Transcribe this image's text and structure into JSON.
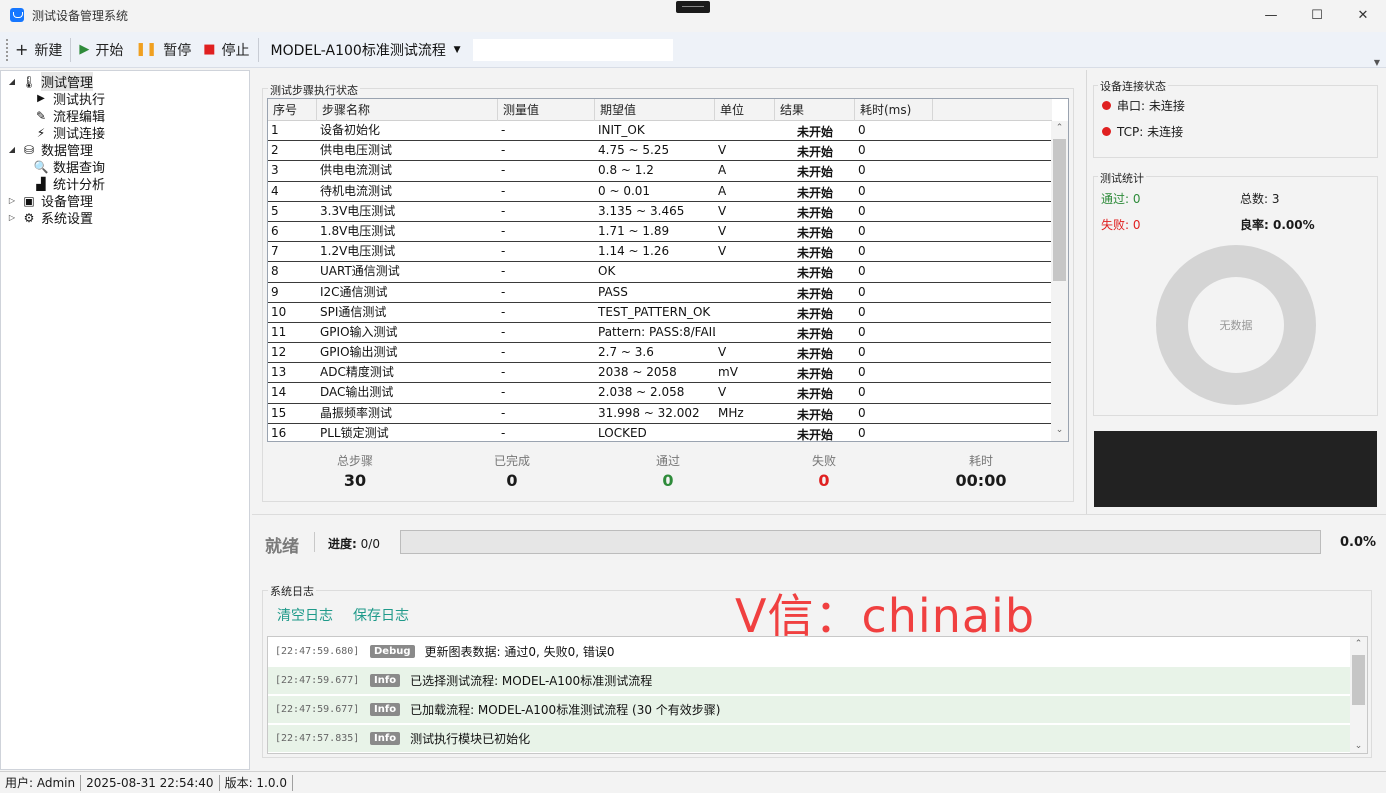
{
  "window": {
    "title": "测试设备管理系统",
    "minimize": "—",
    "maximize": "☐",
    "close": "✕"
  },
  "toolbar": {
    "new_label": "新建",
    "start_label": "开始",
    "pause_label": "暂停",
    "stop_label": "停止",
    "flow_selected": "MODEL-A100标准测试流程",
    "input_value": ""
  },
  "tree": [
    {
      "label": "测试管理",
      "level": 0,
      "expanded": true,
      "icon": "thermometer-icon"
    },
    {
      "label": "测试执行",
      "level": 1,
      "icon": "play-icon"
    },
    {
      "label": "流程编辑",
      "level": 1,
      "icon": "file-edit-icon"
    },
    {
      "label": "测试连接",
      "level": 1,
      "icon": "plug-icon"
    },
    {
      "label": "数据管理",
      "level": 0,
      "expanded": true,
      "icon": "database-icon"
    },
    {
      "label": "数据查询",
      "level": 1,
      "icon": "search-icon"
    },
    {
      "label": "统计分析",
      "level": 1,
      "icon": "bar-chart-icon"
    },
    {
      "label": "设备管理",
      "level": 0,
      "expanded": false,
      "icon": "device-icon"
    },
    {
      "label": "系统设置",
      "level": 0,
      "expanded": false,
      "icon": "gear-icon"
    }
  ],
  "steps": {
    "group_title": "测试步骤执行状态",
    "columns": [
      "序号",
      "步骤名称",
      "测量值",
      "期望值",
      "单位",
      "结果",
      "耗时(ms)"
    ],
    "rows": [
      [
        "1",
        "设备初始化",
        "-",
        "INIT_OK",
        "",
        "未开始",
        "0"
      ],
      [
        "2",
        "供电电压测试",
        "-",
        "4.75 ~ 5.25",
        "V",
        "未开始",
        "0"
      ],
      [
        "3",
        "供电电流测试",
        "-",
        "0.8 ~ 1.2",
        "A",
        "未开始",
        "0"
      ],
      [
        "4",
        "待机电流测试",
        "-",
        "0 ~ 0.01",
        "A",
        "未开始",
        "0"
      ],
      [
        "5",
        "3.3V电压测试",
        "-",
        "3.135 ~ 3.465",
        "V",
        "未开始",
        "0"
      ],
      [
        "6",
        "1.8V电压测试",
        "-",
        "1.71 ~ 1.89",
        "V",
        "未开始",
        "0"
      ],
      [
        "7",
        "1.2V电压测试",
        "-",
        "1.14 ~ 1.26",
        "V",
        "未开始",
        "0"
      ],
      [
        "8",
        "UART通信测试",
        "-",
        "OK",
        "",
        "未开始",
        "0"
      ],
      [
        "9",
        "I2C通信测试",
        "-",
        "PASS",
        "",
        "未开始",
        "0"
      ],
      [
        "10",
        "SPI通信测试",
        "-",
        "TEST_PATTERN_OK",
        "",
        "未开始",
        "0"
      ],
      [
        "11",
        "GPIO输入测试",
        "-",
        "Pattern: PASS:8/FAIL",
        "",
        "未开始",
        "0"
      ],
      [
        "12",
        "GPIO输出测试",
        "-",
        "2.7 ~ 3.6",
        "V",
        "未开始",
        "0"
      ],
      [
        "13",
        "ADC精度测试",
        "-",
        "2038 ~ 2058",
        "mV",
        "未开始",
        "0"
      ],
      [
        "14",
        "DAC输出测试",
        "-",
        "2.038 ~ 2.058",
        "V",
        "未开始",
        "0"
      ],
      [
        "15",
        "晶振频率测试",
        "-",
        "31.998 ~ 32.002",
        "MHz",
        "未开始",
        "0"
      ],
      [
        "16",
        "PLL锁定测试",
        "-",
        "LOCKED",
        "",
        "未开始",
        "0"
      ]
    ],
    "summary": [
      {
        "label": "总步骤",
        "value": "30",
        "color": "#111111"
      },
      {
        "label": "已完成",
        "value": "0",
        "color": "#111111"
      },
      {
        "label": "通过",
        "value": "0",
        "color": "#2e8b3a"
      },
      {
        "label": "失败",
        "value": "0",
        "color": "#e02020"
      },
      {
        "label": "耗时",
        "value": "00:00",
        "color": "#111111"
      }
    ]
  },
  "connection": {
    "title": "设备连接状态",
    "serial": "串口: 未连接",
    "tcp": "TCP: 未连接"
  },
  "stats": {
    "title": "测试统计",
    "pass": "通过: 0",
    "total": "总数: 3",
    "fail": "失败: 0",
    "yield_label": "良率:",
    "yield_value": "0.00%",
    "donut_text": "无数据"
  },
  "progress": {
    "status": "就绪",
    "label": "进度:",
    "count": "0/0",
    "percent": "0.0%",
    "fraction": 0
  },
  "log": {
    "title": "系统日志",
    "clear_label": "清空日志",
    "save_label": "保存日志",
    "entries": [
      {
        "time": "[22:47:59.680]",
        "level": "Debug",
        "message": "更新图表数据: 通过0, 失败0, 错误0"
      },
      {
        "time": "[22:47:59.677]",
        "level": "Info",
        "message": "已选择测试流程: MODEL-A100标准测试流程"
      },
      {
        "time": "[22:47:59.677]",
        "level": "Info",
        "message": "已加载流程: MODEL-A100标准测试流程 (30 个有效步骤)"
      },
      {
        "time": "[22:47:57.835]",
        "level": "Info",
        "message": "测试执行模块已初始化"
      }
    ]
  },
  "watermark": "V信：chinaib",
  "statusbar": {
    "user": "用户: Admin",
    "datetime": "2025-08-31 22:54:40",
    "version": "版本: 1.0.0"
  },
  "colors": {
    "pass": "#2e8b3a",
    "fail": "#e02020",
    "link": "#1f9a8a",
    "accent": "#1677ff"
  }
}
